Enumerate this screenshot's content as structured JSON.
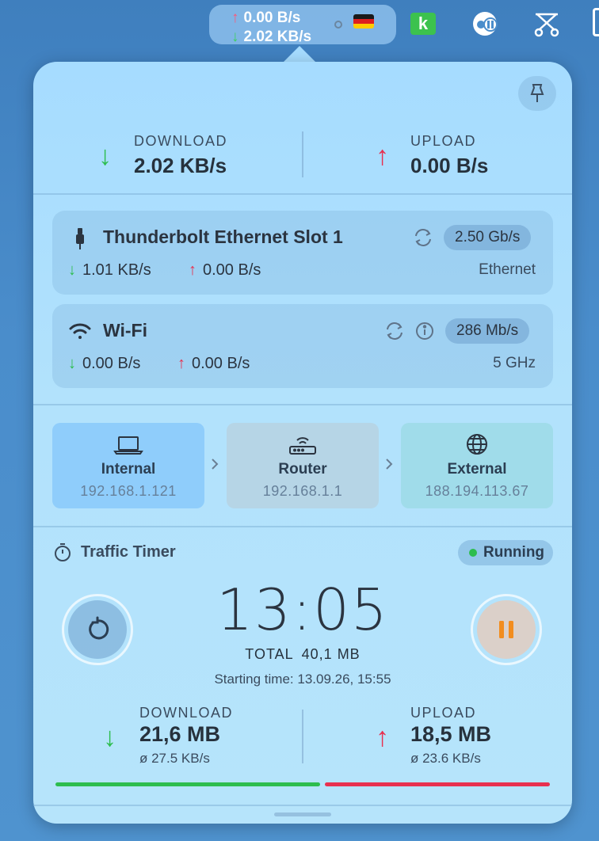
{
  "menubar": {
    "upload_rate": "0.00 B/s",
    "download_rate": "2.02 KB/s",
    "k_app_letter": "k",
    "icons": [
      "flag-germany-icon",
      "k-app-icon",
      "vpn-icon",
      "scissors-tool-icon"
    ]
  },
  "summary": {
    "download_label": "DOWNLOAD",
    "download_value": "2.02 KB/s",
    "upload_label": "UPLOAD",
    "upload_value": "0.00 B/s"
  },
  "interfaces": [
    {
      "name": "Thunderbolt Ethernet Slot 1",
      "link_speed": "2.50 Gb/s",
      "download": "1.01 KB/s",
      "upload": "0.00 B/s",
      "type": "Ethernet",
      "icon": "ethernet-cable-icon"
    },
    {
      "name": "Wi-Fi",
      "link_speed": "286 Mb/s",
      "download": "0.00 B/s",
      "upload": "0.00 B/s",
      "type": "5 GHz",
      "icon": "wifi-icon"
    }
  ],
  "path": {
    "internal": {
      "label": "Internal",
      "ip": "192.168.1.121"
    },
    "router": {
      "label": "Router",
      "ip": "192.168.1.1"
    },
    "external": {
      "label": "External",
      "ip": "188.194.113.67"
    }
  },
  "timer": {
    "title": "Traffic Timer",
    "status": "Running",
    "elapsed": "13:05",
    "total_label": "TOTAL",
    "total_value": "40,1 MB",
    "start_label": "Starting time:",
    "start_value": "13.09.26, 15:55",
    "download_label": "DOWNLOAD",
    "download_value": "21,6 MB",
    "download_avg": "ø 27.5 KB/s",
    "upload_label": "UPLOAD",
    "upload_value": "18,5 MB",
    "upload_avg": "ø 23.6 KB/s",
    "download_share": 0.54,
    "upload_share": 0.46
  },
  "arrows": {
    "down": "↓",
    "up": "↑"
  },
  "colors": {
    "download": "#2dbd4e",
    "upload": "#e8304f",
    "pause": "#f28d1f",
    "internal_bg": "#8fcdfb",
    "router_bg": "#b6d5e6",
    "external_bg": "#a0dcea"
  }
}
